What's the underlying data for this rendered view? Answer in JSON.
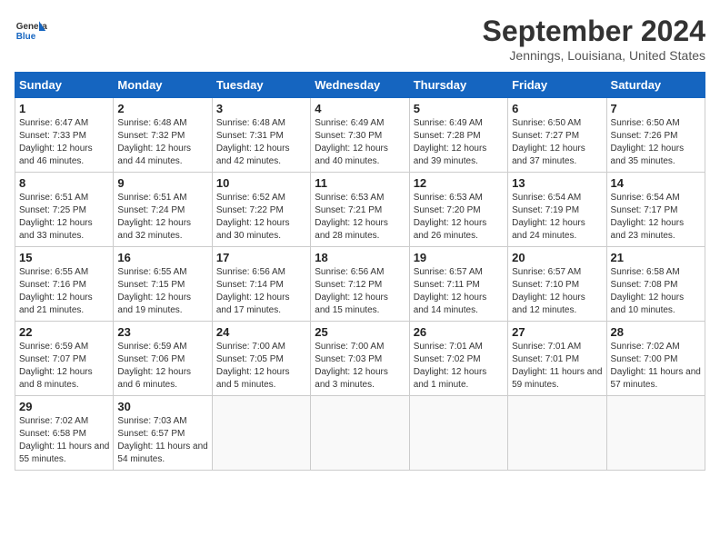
{
  "header": {
    "logo_general": "General",
    "logo_blue": "Blue",
    "month_title": "September 2024",
    "location": "Jennings, Louisiana, United States"
  },
  "days_of_week": [
    "Sunday",
    "Monday",
    "Tuesday",
    "Wednesday",
    "Thursday",
    "Friday",
    "Saturday"
  ],
  "weeks": [
    [
      {
        "day": 1,
        "sunrise": "6:47 AM",
        "sunset": "7:33 PM",
        "daylight": "12 hours and 46 minutes."
      },
      {
        "day": 2,
        "sunrise": "6:48 AM",
        "sunset": "7:32 PM",
        "daylight": "12 hours and 44 minutes."
      },
      {
        "day": 3,
        "sunrise": "6:48 AM",
        "sunset": "7:31 PM",
        "daylight": "12 hours and 42 minutes."
      },
      {
        "day": 4,
        "sunrise": "6:49 AM",
        "sunset": "7:30 PM",
        "daylight": "12 hours and 40 minutes."
      },
      {
        "day": 5,
        "sunrise": "6:49 AM",
        "sunset": "7:28 PM",
        "daylight": "12 hours and 39 minutes."
      },
      {
        "day": 6,
        "sunrise": "6:50 AM",
        "sunset": "7:27 PM",
        "daylight": "12 hours and 37 minutes."
      },
      {
        "day": 7,
        "sunrise": "6:50 AM",
        "sunset": "7:26 PM",
        "daylight": "12 hours and 35 minutes."
      }
    ],
    [
      {
        "day": 8,
        "sunrise": "6:51 AM",
        "sunset": "7:25 PM",
        "daylight": "12 hours and 33 minutes."
      },
      {
        "day": 9,
        "sunrise": "6:51 AM",
        "sunset": "7:24 PM",
        "daylight": "12 hours and 32 minutes."
      },
      {
        "day": 10,
        "sunrise": "6:52 AM",
        "sunset": "7:22 PM",
        "daylight": "12 hours and 30 minutes."
      },
      {
        "day": 11,
        "sunrise": "6:53 AM",
        "sunset": "7:21 PM",
        "daylight": "12 hours and 28 minutes."
      },
      {
        "day": 12,
        "sunrise": "6:53 AM",
        "sunset": "7:20 PM",
        "daylight": "12 hours and 26 minutes."
      },
      {
        "day": 13,
        "sunrise": "6:54 AM",
        "sunset": "7:19 PM",
        "daylight": "12 hours and 24 minutes."
      },
      {
        "day": 14,
        "sunrise": "6:54 AM",
        "sunset": "7:17 PM",
        "daylight": "12 hours and 23 minutes."
      }
    ],
    [
      {
        "day": 15,
        "sunrise": "6:55 AM",
        "sunset": "7:16 PM",
        "daylight": "12 hours and 21 minutes."
      },
      {
        "day": 16,
        "sunrise": "6:55 AM",
        "sunset": "7:15 PM",
        "daylight": "12 hours and 19 minutes."
      },
      {
        "day": 17,
        "sunrise": "6:56 AM",
        "sunset": "7:14 PM",
        "daylight": "12 hours and 17 minutes."
      },
      {
        "day": 18,
        "sunrise": "6:56 AM",
        "sunset": "7:12 PM",
        "daylight": "12 hours and 15 minutes."
      },
      {
        "day": 19,
        "sunrise": "6:57 AM",
        "sunset": "7:11 PM",
        "daylight": "12 hours and 14 minutes."
      },
      {
        "day": 20,
        "sunrise": "6:57 AM",
        "sunset": "7:10 PM",
        "daylight": "12 hours and 12 minutes."
      },
      {
        "day": 21,
        "sunrise": "6:58 AM",
        "sunset": "7:08 PM",
        "daylight": "12 hours and 10 minutes."
      }
    ],
    [
      {
        "day": 22,
        "sunrise": "6:59 AM",
        "sunset": "7:07 PM",
        "daylight": "12 hours and 8 minutes."
      },
      {
        "day": 23,
        "sunrise": "6:59 AM",
        "sunset": "7:06 PM",
        "daylight": "12 hours and 6 minutes."
      },
      {
        "day": 24,
        "sunrise": "7:00 AM",
        "sunset": "7:05 PM",
        "daylight": "12 hours and 5 minutes."
      },
      {
        "day": 25,
        "sunrise": "7:00 AM",
        "sunset": "7:03 PM",
        "daylight": "12 hours and 3 minutes."
      },
      {
        "day": 26,
        "sunrise": "7:01 AM",
        "sunset": "7:02 PM",
        "daylight": "12 hours and 1 minute."
      },
      {
        "day": 27,
        "sunrise": "7:01 AM",
        "sunset": "7:01 PM",
        "daylight": "11 hours and 59 minutes."
      },
      {
        "day": 28,
        "sunrise": "7:02 AM",
        "sunset": "7:00 PM",
        "daylight": "11 hours and 57 minutes."
      }
    ],
    [
      {
        "day": 29,
        "sunrise": "7:02 AM",
        "sunset": "6:58 PM",
        "daylight": "11 hours and 55 minutes."
      },
      {
        "day": 30,
        "sunrise": "7:03 AM",
        "sunset": "6:57 PM",
        "daylight": "11 hours and 54 minutes."
      },
      null,
      null,
      null,
      null,
      null
    ]
  ]
}
